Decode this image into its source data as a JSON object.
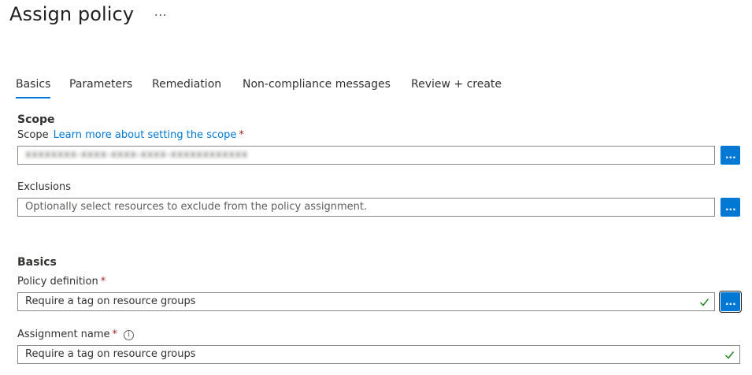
{
  "header": {
    "title": "Assign policy",
    "more_label": "···"
  },
  "tabs": [
    {
      "label": "Basics"
    },
    {
      "label": "Parameters"
    },
    {
      "label": "Remediation"
    },
    {
      "label": "Non-compliance messages"
    },
    {
      "label": "Review + create"
    }
  ],
  "scope_section": {
    "heading": "Scope",
    "scope_label": "Scope",
    "scope_link": "Learn more about setting the scope",
    "required_mark": "*",
    "scope_value": "xxxxxxxx-xxxx-xxxx-xxxx-xxxxxxxxxxxx",
    "browse_label": "...",
    "exclusions_label": "Exclusions",
    "exclusions_placeholder": "Optionally select resources to exclude from the policy assignment."
  },
  "basics_section": {
    "heading": "Basics",
    "policy_definition_label": "Policy definition",
    "policy_definition_value": "Require a tag on resource groups",
    "assignment_name_label": "Assignment name",
    "assignment_name_value": "Require a tag on resource groups",
    "required_mark": "*",
    "info_glyph": "i"
  },
  "colors": {
    "accent": "#0078d4",
    "required": "#a4262c",
    "valid_check": "#107c10"
  },
  "icons": {
    "more": "more-icon",
    "check": "check-icon",
    "info": "info-icon"
  }
}
